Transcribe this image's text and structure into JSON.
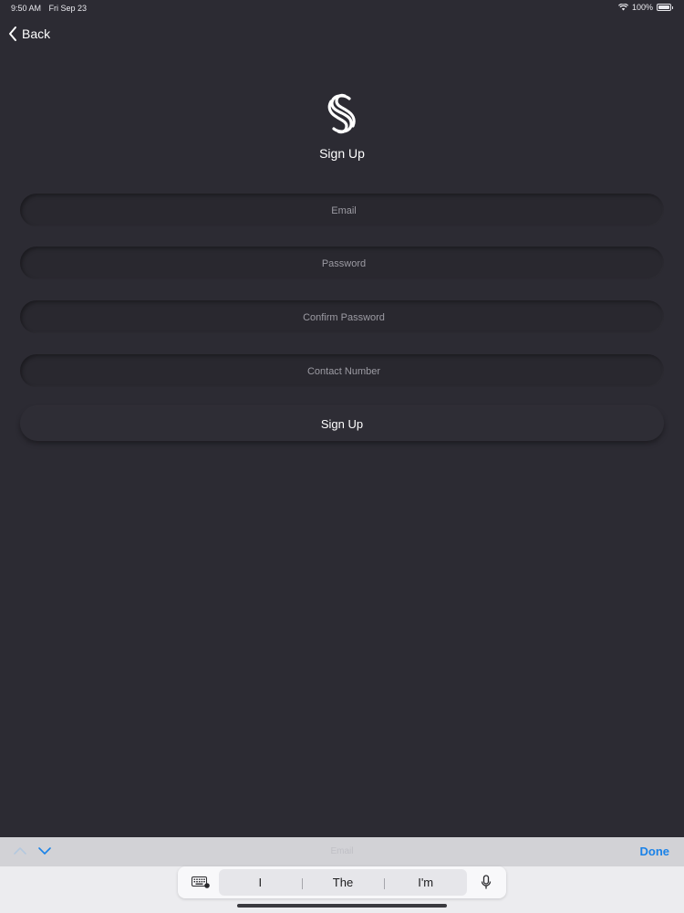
{
  "status_bar": {
    "time": "9:50 AM",
    "date": "Fri Sep 23",
    "battery": "100%",
    "icons": [
      "wifi-icon",
      "battery-icon"
    ]
  },
  "nav": {
    "back_label": "Back",
    "back_icon": "chevron-left-icon"
  },
  "header": {
    "logo_icon": "app-logo-icon",
    "title": "Sign Up"
  },
  "form": {
    "email_placeholder": "Email",
    "password_placeholder": "Password",
    "confirm_password_placeholder": "Confirm Password",
    "contact_number_placeholder": "Contact Number",
    "submit_label": "Sign Up"
  },
  "keyboard": {
    "accessory": {
      "prev_icon": "chevron-up-icon",
      "next_icon": "chevron-down-icon",
      "field_label": "Email",
      "done_label": "Done"
    },
    "predictions": [
      "I",
      "The",
      "I'm"
    ],
    "keyboard_icon": "keyboard-icon",
    "mic_icon": "microphone-icon"
  },
  "colors": {
    "background": "#2c2b33",
    "accent": "#1a82e8",
    "text": "#ffffff"
  }
}
